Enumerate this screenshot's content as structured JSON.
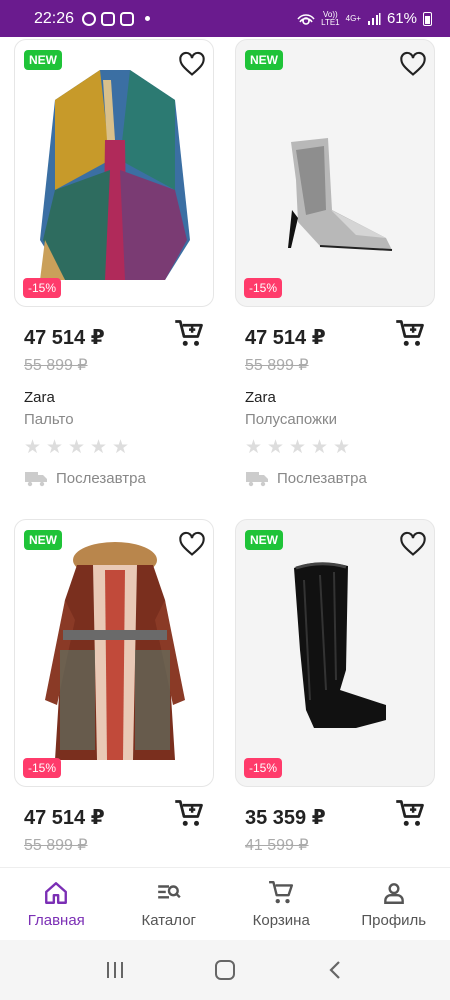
{
  "status": {
    "time": "22:26",
    "network_top": "Vo))",
    "network_bottom": "LTE1",
    "net_type": "4G+",
    "battery": "61%"
  },
  "products": [
    {
      "badge_new": "NEW",
      "discount": "-15%",
      "price": "47 514 ₽",
      "old_price": "55 899 ₽",
      "brand": "Zara",
      "type": "Пальто",
      "delivery": "Послезавтра",
      "image": "poncho-coat"
    },
    {
      "badge_new": "NEW",
      "discount": "-15%",
      "price": "47 514 ₽",
      "old_price": "55 899 ₽",
      "brand": "Zara",
      "type": "Полусапожки",
      "delivery": "Послезавтра",
      "image": "sequin-ankle-boot"
    },
    {
      "badge_new": "NEW",
      "discount": "-15%",
      "price": "47 514 ₽",
      "old_price": "55 899 ₽",
      "brand": "",
      "type": "",
      "delivery": "",
      "image": "fur-trim-coat"
    },
    {
      "badge_new": "NEW",
      "discount": "-15%",
      "price": "35 359 ₽",
      "old_price": "41 599 ₽",
      "brand": "",
      "type": "",
      "delivery": "",
      "image": "fur-knee-boot"
    }
  ],
  "nav": {
    "home": "Главная",
    "catalog": "Каталог",
    "cart": "Корзина",
    "profile": "Профиль"
  },
  "colors": {
    "accent": "#7b2fb5",
    "status_bar": "#6a1b8e",
    "new_badge": "#1fc338",
    "sale_badge": "#ff3b6b"
  }
}
